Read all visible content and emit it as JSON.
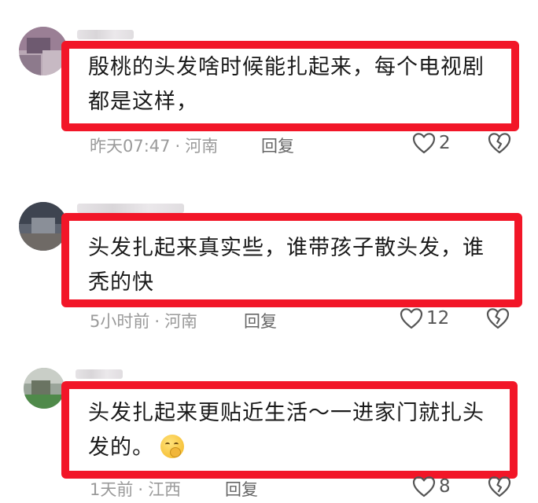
{
  "comments": [
    {
      "text_line1": "殷桃的头发啥时候能扎起来，每个电视剧",
      "text_line2": "都是这样，",
      "time": "昨天07:47",
      "location": "河南",
      "reply_label": "回复",
      "likes": "2"
    },
    {
      "text_line1": "头发扎起来真实些，谁带孩子散头发，谁",
      "text_line2": "秃的快",
      "time": "5小时前",
      "location": "河南",
      "reply_label": "回复",
      "likes": "12"
    },
    {
      "text_line1": "头发扎起来更贴近生活～一进家门就扎头",
      "text_line2": "发的。",
      "time": "1天前",
      "location": "江西",
      "reply_label": "回复",
      "likes": "8",
      "emoji": "shushing-face-emoji"
    }
  ],
  "meta_separator": "·",
  "colors": {
    "highlight_border": "#f21628",
    "meta_text": "#9a9a9a",
    "reply_text": "#666666"
  },
  "icons": [
    "heart-outline-icon",
    "broken-heart-icon"
  ]
}
